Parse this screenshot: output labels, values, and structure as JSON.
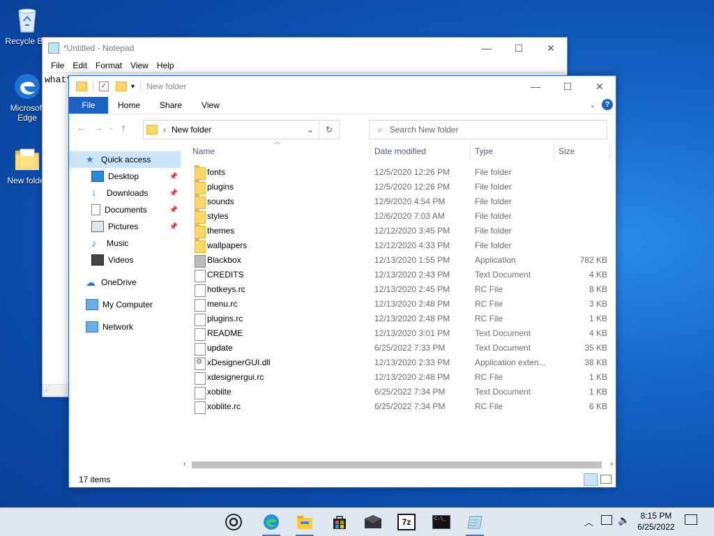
{
  "desktop": {
    "icons": [
      {
        "label": "Recycle Bin",
        "icon": "recycle-bin-icon"
      },
      {
        "label": "Microsoft Edge",
        "icon": "edge-icon"
      },
      {
        "label": "New folder",
        "icon": "folder-icon"
      }
    ]
  },
  "notepad": {
    "title": "*Untitled - Notepad",
    "menu": [
      "File",
      "Edit",
      "Format",
      "View",
      "Help"
    ],
    "content": "what?"
  },
  "explorer": {
    "title": "New folder",
    "ribbon_tabs": [
      "File",
      "Home",
      "Share",
      "View"
    ],
    "address": "New folder",
    "search_placeholder": "Search New folder",
    "sidebar": [
      {
        "label": "Quick access",
        "icon": "star-icon",
        "selected": true
      },
      {
        "label": "Desktop",
        "icon": "desktop-icon",
        "pinned": true
      },
      {
        "label": "Downloads",
        "icon": "download-icon",
        "pinned": true
      },
      {
        "label": "Documents",
        "icon": "documents-icon",
        "pinned": true
      },
      {
        "label": "Pictures",
        "icon": "pictures-icon",
        "pinned": true
      },
      {
        "label": "Music",
        "icon": "music-icon"
      },
      {
        "label": "Videos",
        "icon": "videos-icon"
      },
      {
        "label": "OneDrive",
        "icon": "cloud-icon"
      },
      {
        "label": "My Computer",
        "icon": "computer-icon"
      },
      {
        "label": "Network",
        "icon": "network-icon"
      }
    ],
    "columns": {
      "name": "Name",
      "date": "Date modified",
      "type": "Type",
      "size": "Size"
    },
    "files": [
      {
        "name": "fonts",
        "date": "12/5/2020 12:26 PM",
        "type": "File folder",
        "size": "",
        "kind": "folder"
      },
      {
        "name": "plugins",
        "date": "12/5/2020 12:26 PM",
        "type": "File folder",
        "size": "",
        "kind": "folder"
      },
      {
        "name": "sounds",
        "date": "12/9/2020 4:54 PM",
        "type": "File folder",
        "size": "",
        "kind": "folder"
      },
      {
        "name": "styles",
        "date": "12/6/2020 7:03 AM",
        "type": "File folder",
        "size": "",
        "kind": "folder"
      },
      {
        "name": "themes",
        "date": "12/12/2020 3:45 PM",
        "type": "File folder",
        "size": "",
        "kind": "folder"
      },
      {
        "name": "wallpapers",
        "date": "12/12/2020 4:33 PM",
        "type": "File folder",
        "size": "",
        "kind": "folder"
      },
      {
        "name": "Blackbox",
        "date": "12/13/2020 1:55 PM",
        "type": "Application",
        "size": "782 KB",
        "kind": "app"
      },
      {
        "name": "CREDITS",
        "date": "12/13/2020 2:43 PM",
        "type": "Text Document",
        "size": "4 KB",
        "kind": "doc"
      },
      {
        "name": "hotkeys.rc",
        "date": "12/13/2020 2:45 PM",
        "type": "RC File",
        "size": "8 KB",
        "kind": "doc"
      },
      {
        "name": "menu.rc",
        "date": "12/13/2020 2:48 PM",
        "type": "RC File",
        "size": "3 KB",
        "kind": "doc"
      },
      {
        "name": "plugins.rc",
        "date": "12/13/2020 2:48 PM",
        "type": "RC File",
        "size": "1 KB",
        "kind": "doc"
      },
      {
        "name": "README",
        "date": "12/13/2020 3:01 PM",
        "type": "Text Document",
        "size": "4 KB",
        "kind": "doc"
      },
      {
        "name": "update",
        "date": "6/25/2022 7:33 PM",
        "type": "Text Document",
        "size": "35 KB",
        "kind": "doc"
      },
      {
        "name": "xDesignerGUI.dll",
        "date": "12/13/2020 2:33 PM",
        "type": "Application exten...",
        "size": "38 KB",
        "kind": "dll"
      },
      {
        "name": "xdesignergui.rc",
        "date": "12/13/2020 2:48 PM",
        "type": "RC File",
        "size": "1 KB",
        "kind": "doc"
      },
      {
        "name": "xoblite",
        "date": "6/25/2022 7:34 PM",
        "type": "Text Document",
        "size": "1 KB",
        "kind": "doc"
      },
      {
        "name": "xoblite.rc",
        "date": "6/25/2022 7:34 PM",
        "type": "RC File",
        "size": "6 KB",
        "kind": "doc"
      }
    ],
    "status": "17 items"
  },
  "taskbar": {
    "time": "8:15 PM",
    "date": "6/25/2022",
    "apps": [
      "cortana-icon",
      "edge-icon",
      "file-explorer-icon",
      "store-icon",
      "mail-icon",
      "7zip-icon",
      "terminal-icon",
      "notepad-icon"
    ],
    "label_7z": "7z"
  }
}
